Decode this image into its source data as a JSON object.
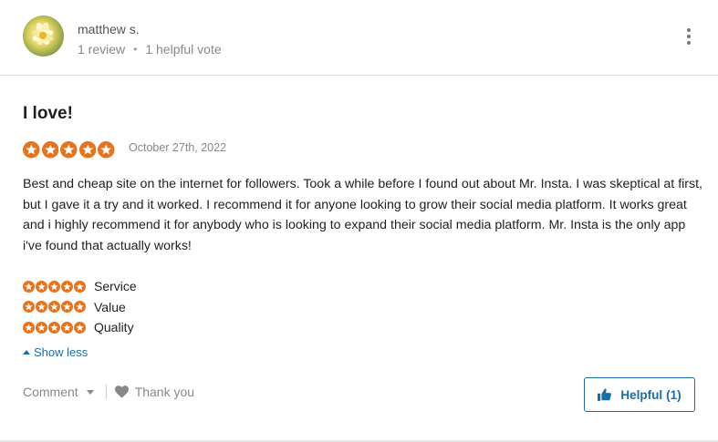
{
  "colors": {
    "star_fill": "#e8731d",
    "accent_blue": "#1a6ea8",
    "muted_text": "#888888"
  },
  "reviewer": {
    "name": "matthew s.",
    "reviews": "1 review",
    "separator": "•",
    "helpful_votes": "1 helpful vote",
    "avatar_icon": "water-lily-avatar"
  },
  "menu": {
    "icon": "kebab-menu-icon"
  },
  "review": {
    "title": "I love!",
    "rating": 5,
    "rating_max": 5,
    "date": "October 27th, 2022",
    "body": "Best and cheap site on the internet for followers. Took a while before I found out about Mr. Insta. I was skeptical at first, but I gave it a try and it worked. I recommend it for anyone looking to grow their social media platform. It works great and i highly recommend it for anybody who is looking to expand their social media platform. Mr. Insta is the only app i've found that actually works!"
  },
  "subratings": [
    {
      "label": "Service",
      "rating": 5
    },
    {
      "label": "Value",
      "rating": 5
    },
    {
      "label": "Quality",
      "rating": 5
    }
  ],
  "toggle": {
    "label": "Show less",
    "icon": "caret-up-icon"
  },
  "footer": {
    "comment_label": "Comment",
    "thank_label": "Thank you",
    "helpful_label": "Helpful",
    "helpful_count": "(1)"
  }
}
